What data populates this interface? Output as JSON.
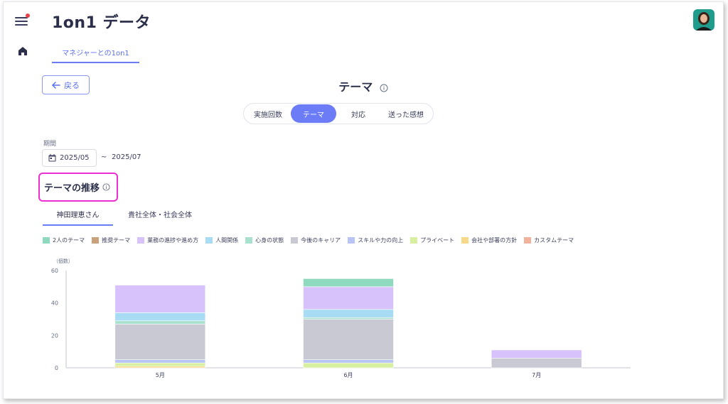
{
  "app": {
    "title": "1on1 データ"
  },
  "nav": {
    "menu_icon": "hamburger-menu-icon",
    "home_icon": "home-icon"
  },
  "subtabs": [
    {
      "label": "マネジャーとの1on1"
    }
  ],
  "back_button": {
    "label": "戻る"
  },
  "page": {
    "title": "テーマ"
  },
  "segments": [
    {
      "label": "実施回数",
      "active": false
    },
    {
      "label": "テーマ",
      "active": true
    },
    {
      "label": "対応",
      "active": false
    },
    {
      "label": "送った感想",
      "active": false
    }
  ],
  "period": {
    "label": "期間",
    "start": "2025/05",
    "separator": "~",
    "end": "2025/07"
  },
  "section": {
    "title": "テーマの推移"
  },
  "person_tabs": [
    {
      "label": "神田理恵さん",
      "active": true
    },
    {
      "label": "貴社全体・社会全体",
      "active": false
    }
  ],
  "colors": {
    "accent": "#6b7cf6",
    "highlight": "#ec2fd0"
  },
  "chart_data": {
    "type": "bar",
    "stacked": true,
    "categories": [
      "5月",
      "6月",
      "7月"
    ],
    "ylabel": "（個数）",
    "ylim": [
      0,
      60
    ],
    "yticks": [
      0,
      20,
      40,
      60
    ],
    "series": [
      {
        "name": "2人のテーマ",
        "color": "#8fd9bf",
        "values": [
          0,
          0,
          0
        ]
      },
      {
        "name": "推奨テーマ",
        "color": "#c9a27b",
        "values": [
          0,
          0,
          0
        ]
      },
      {
        "name": "業務の進捗や進め方",
        "color": "#d7c2fb",
        "values": [
          0,
          0,
          0
        ]
      },
      {
        "name": "人間関係",
        "color": "#a8dcf5",
        "values": [
          0,
          0,
          0
        ]
      },
      {
        "name": "心身の状態",
        "color": "#a8e2cf",
        "values": [
          0,
          0,
          0
        ]
      },
      {
        "name": "今後のキャリア",
        "color": "#c8c9d2",
        "values": [
          0,
          0,
          0
        ]
      },
      {
        "name": "スキルや力の向上",
        "color": "#b7c4f5",
        "values": [
          0,
          0,
          0
        ]
      },
      {
        "name": "プライベート",
        "color": "#d7ef9f",
        "values": [
          0,
          0,
          0
        ]
      },
      {
        "name": "会社や部署の方針",
        "color": "#f8d98a",
        "values": [
          0,
          0,
          0
        ]
      },
      {
        "name": "カスタムテーマ",
        "color": "#f3b29c",
        "values": [
          0,
          0,
          0
        ]
      }
    ],
    "stack_order": [
      "会社や部署の方針",
      "プライベート",
      "スキルや力の向上",
      "今後のキャリア",
      "心身の状態",
      "人間関係",
      "業務の進捗や進め方",
      "2人のテーマ"
    ],
    "stack_values": {
      "会社や部署の方針": [
        1,
        0,
        0
      ],
      "プライベート": [
        2,
        3,
        0
      ],
      "スキルや力の向上": [
        2,
        2,
        0
      ],
      "今後のキャリア": [
        22,
        25,
        6
      ],
      "心身の状態": [
        2,
        1,
        0
      ],
      "人間関係": [
        5,
        5,
        0
      ],
      "業務の進捗や進め方": [
        17,
        14,
        5
      ],
      "2人のテーマ": [
        0,
        5,
        0
      ]
    }
  }
}
